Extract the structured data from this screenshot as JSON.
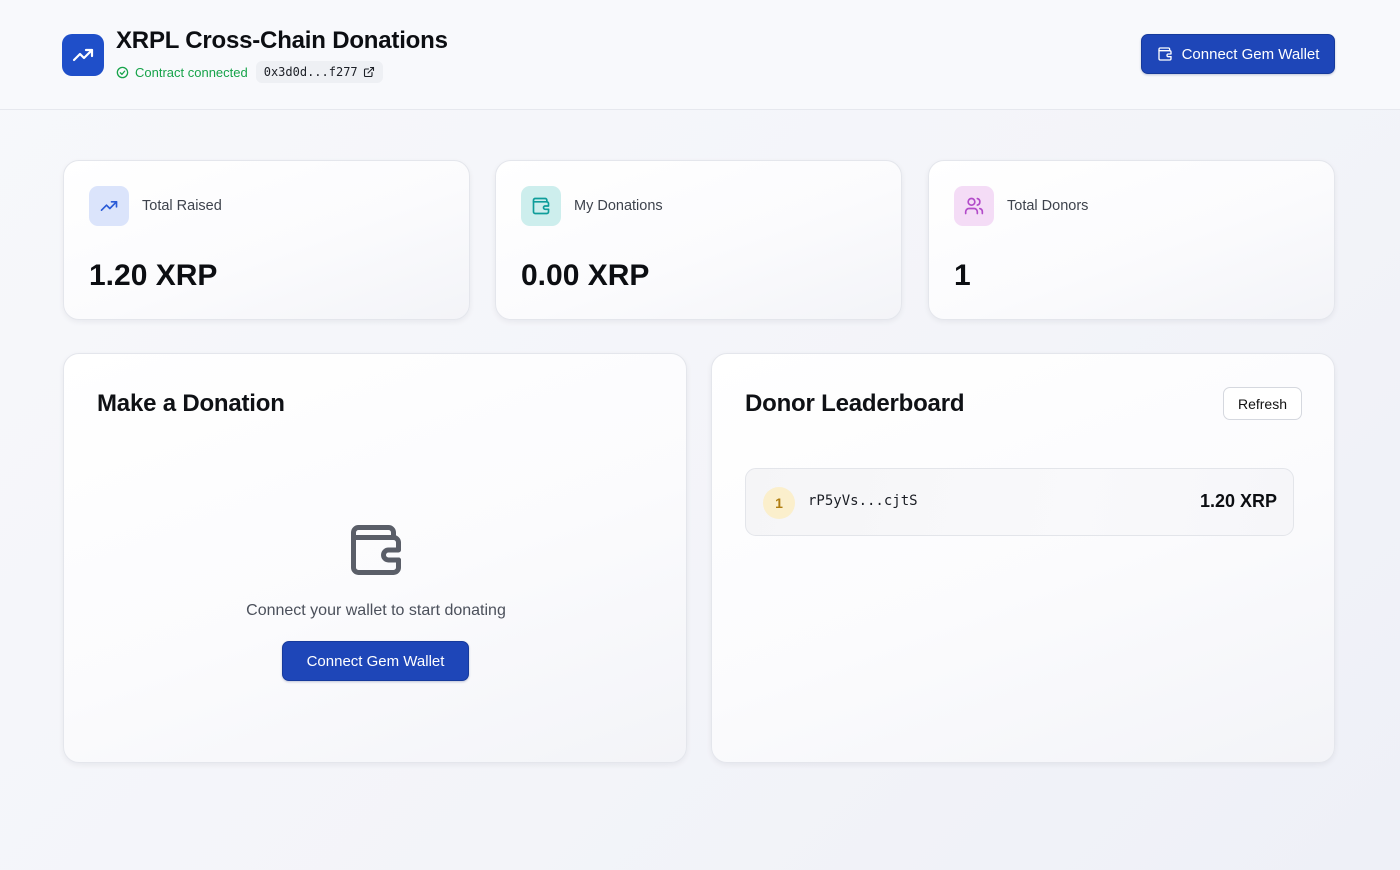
{
  "header": {
    "title": "XRPL Cross-Chain Donations",
    "status": "Contract connected",
    "contract_address": "0x3d0d...f277",
    "connect_label": "Connect Gem Wallet"
  },
  "stats": [
    {
      "label": "Total Raised",
      "value": "1.20 XRP",
      "icon": "trending-up-icon",
      "color": "#2a5bd7"
    },
    {
      "label": "My Donations",
      "value": "0.00 XRP",
      "icon": "wallet-icon",
      "color": "#0f9d9a"
    },
    {
      "label": "Total Donors",
      "value": "1",
      "icon": "users-icon",
      "color": "#b24ac9"
    }
  ],
  "donate": {
    "title": "Make a Donation",
    "message": "Connect your wallet to start donating",
    "connect_label": "Connect Gem Wallet"
  },
  "leaderboard": {
    "title": "Donor Leaderboard",
    "refresh_label": "Refresh",
    "entries": [
      {
        "rank": "1",
        "address": "rP5yVs...cjtS",
        "amount": "1.20 XRP"
      }
    ]
  },
  "colors": {
    "primary": "#1e46b8",
    "success": "#17a34a",
    "rank_gold": "#fbefcc"
  }
}
